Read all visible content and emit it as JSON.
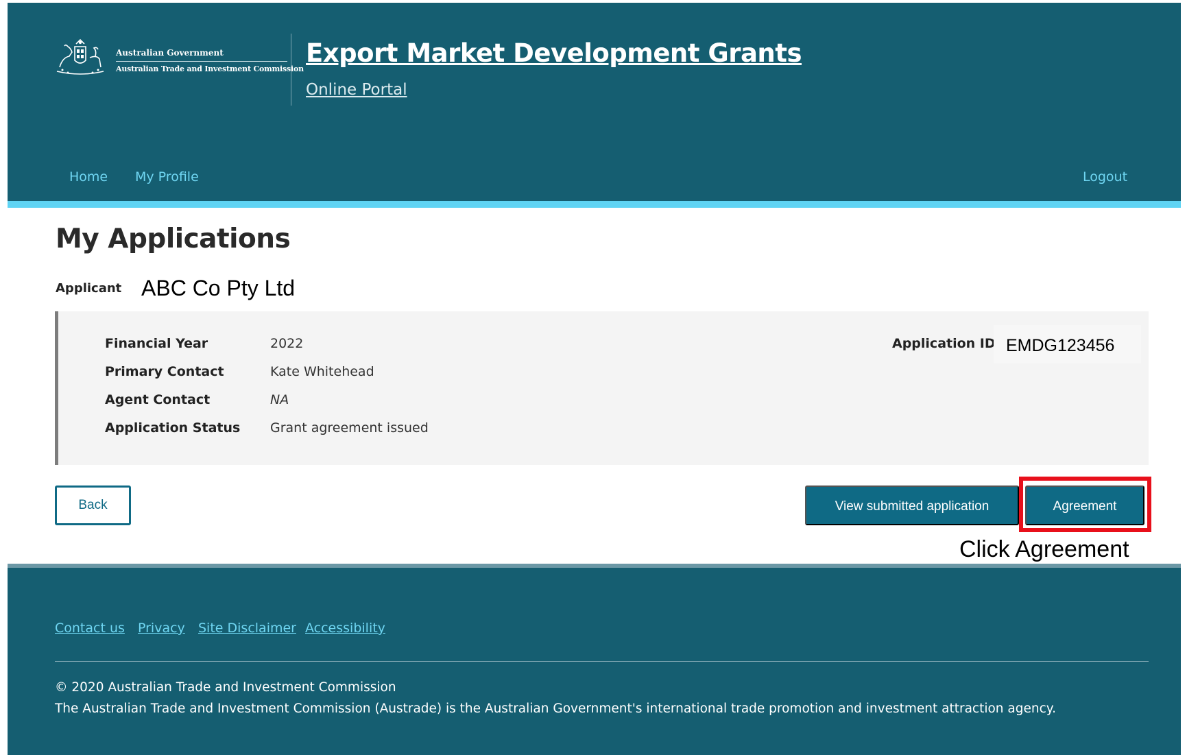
{
  "header": {
    "logo": {
      "government": "Australian Government",
      "agency": "Australian Trade and Investment Commission",
      "icon": "coat-of-arms"
    },
    "site_title": "Export Market Development Grants",
    "site_subtitle": "Online Portal"
  },
  "nav": {
    "home": "Home",
    "my_profile": "My Profile",
    "logout": "Logout"
  },
  "main": {
    "page_title": "My Applications",
    "applicant_label": "Applicant",
    "applicant_name": "ABC Co Pty Ltd",
    "details": [
      {
        "label": "Financial Year",
        "value": "2022"
      },
      {
        "label": "Primary Contact",
        "value": "Kate Whitehead"
      },
      {
        "label": "Agent Contact",
        "value": "NA"
      },
      {
        "label": "Application Status",
        "value": "Grant agreement issued"
      }
    ],
    "application_id_label": "Application ID",
    "application_id": "EMDG123456",
    "buttons": {
      "back": "Back",
      "view_submitted": "View submitted application",
      "agreement": "Agreement"
    },
    "callout": "Click Agreement"
  },
  "footer": {
    "links": {
      "contact_us": "Contact us",
      "privacy": "Privacy",
      "site_disclaimer": "Site Disclaimer",
      "accessibility": "Accessibility"
    },
    "copyright": "© 2020 Australian Trade and Investment Commission",
    "description": "The Australian Trade and Investment Commission (Austrade) is the Australian Government's international trade promotion and investment attraction agency."
  },
  "colors": {
    "header_bg": "#155e71",
    "accent_bar": "#5fd4f4",
    "nav_link": "#6fd6f2",
    "button_primary": "#0f6a85",
    "highlight": "#e8101b"
  }
}
